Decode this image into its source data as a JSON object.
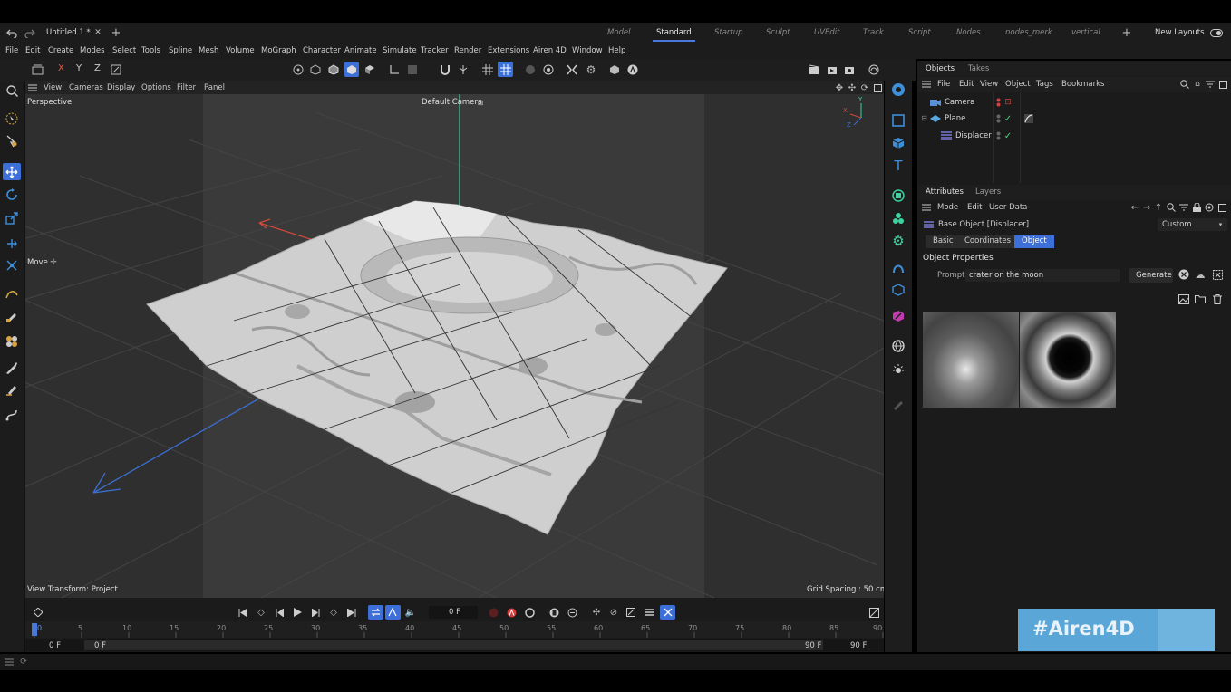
{
  "window": {
    "title": "Untitled 1 *",
    "tabs": [
      "Model",
      "Standard",
      "Startup",
      "Sculpt",
      "UVEdit",
      "Track",
      "Script",
      "Nodes",
      "nodes_merk",
      "vertical"
    ],
    "new_layouts": "New Layouts"
  },
  "menu": [
    "File",
    "Edit",
    "Create",
    "Modes",
    "Select",
    "Tools",
    "Spline",
    "Mesh",
    "Volume",
    "MoGraph",
    "Character",
    "Animate",
    "Simulate",
    "Tracker",
    "Render",
    "Extensions",
    "Airen 4D",
    "Window",
    "Help"
  ],
  "toolbar": {
    "axes": [
      "X",
      "Y",
      "Z"
    ]
  },
  "viewport_menu": [
    "View",
    "Cameras",
    "Display",
    "Options",
    "Filter",
    "Panel"
  ],
  "viewport": {
    "label": "Perspective",
    "camera": "Default Camera",
    "move_label": "Move",
    "view_transform": "View Transform: Project",
    "grid_spacing": "Grid Spacing : 50 cm",
    "axis_x": "X",
    "axis_y": "Y",
    "axis_z": "Z"
  },
  "objects_panel": {
    "tabs": [
      "Objects",
      "Takes"
    ],
    "menu": [
      "File",
      "Edit",
      "View",
      "Object",
      "Tags",
      "Bookmarks"
    ],
    "items": [
      {
        "name": "Camera"
      },
      {
        "name": "Plane"
      },
      {
        "name": "Displacer"
      }
    ]
  },
  "attributes_panel": {
    "tabs": [
      "Attributes",
      "Layers"
    ],
    "menu": [
      "Mode",
      "Edit",
      "User Data"
    ],
    "header": "Base Object [Displacer]",
    "preset": "Custom",
    "subtabs": [
      "Basic",
      "Coordinates",
      "Object"
    ],
    "section": "Object Properties",
    "prompt_label": "Prompt",
    "prompt_value": "crater on the moon",
    "generate_label": "Generate"
  },
  "timeline": {
    "frame_field": "0 F",
    "ticks": [
      "0",
      "5",
      "10",
      "15",
      "20",
      "25",
      "30",
      "35",
      "40",
      "45",
      "50",
      "55",
      "60",
      "65",
      "70",
      "75",
      "80",
      "85",
      "90"
    ],
    "start": "0 F",
    "range_start": "0 F",
    "range_end": "90 F",
    "end": "90 F"
  },
  "watermark": "#Airen4D",
  "colors": {
    "accent": "#3d6fd9",
    "axis_x": "#d44a3a",
    "axis_y": "#3ed0a0",
    "axis_z": "#3a6fd0",
    "watermark_bg": "#5aa6d6"
  }
}
